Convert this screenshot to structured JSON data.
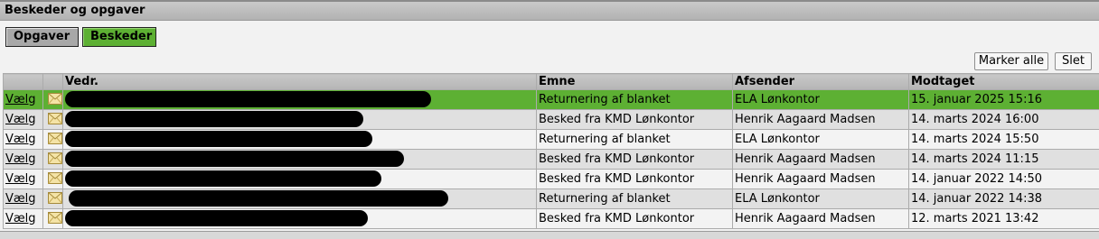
{
  "window": {
    "title": "Beskeder og opgaver"
  },
  "tabs": [
    {
      "label": "Opgaver"
    },
    {
      "label": "Beskeder"
    }
  ],
  "toolbar": {
    "mark_all_label": "Marker alle",
    "delete_label": "Slet"
  },
  "table": {
    "columns": [
      "",
      "",
      "Vedr.",
      "Emne",
      "Afsender",
      "Modtaget"
    ],
    "select_label": "Vælg",
    "rows": [
      {
        "emne": "Returnering af blanket",
        "afsender": "ELA Lønkontor",
        "modtaget": "15. januar 2025 15:16",
        "selected": true
      },
      {
        "emne": "Besked fra KMD Lønkontor",
        "afsender": "Henrik Aagaard Madsen",
        "modtaget": "14. marts 2024 16:00"
      },
      {
        "emne": "Returnering af blanket",
        "afsender": "ELA Lønkontor",
        "modtaget": "14. marts 2024 15:50"
      },
      {
        "emne": "Besked fra KMD Lønkontor",
        "afsender": "Henrik Aagaard Madsen",
        "modtaget": "14. marts 2024 11:15"
      },
      {
        "emne": "Besked fra KMD Lønkontor",
        "afsender": "Henrik Aagaard Madsen",
        "modtaget": "14. januar 2022 14:50"
      },
      {
        "emne": "Returnering af blanket",
        "afsender": "ELA Lønkontor",
        "modtaget": "14. januar 2022 14:38"
      },
      {
        "emne": "Besked fra KMD Lønkontor",
        "afsender": "Henrik Aagaard Madsen",
        "modtaget": "12. marts 2021 13:42"
      }
    ]
  },
  "colors": {
    "accent": "#5db033",
    "header": "#b5b5b5",
    "row_alt": "#e0e0e0"
  },
  "icons": {
    "message": "envelope-icon"
  }
}
